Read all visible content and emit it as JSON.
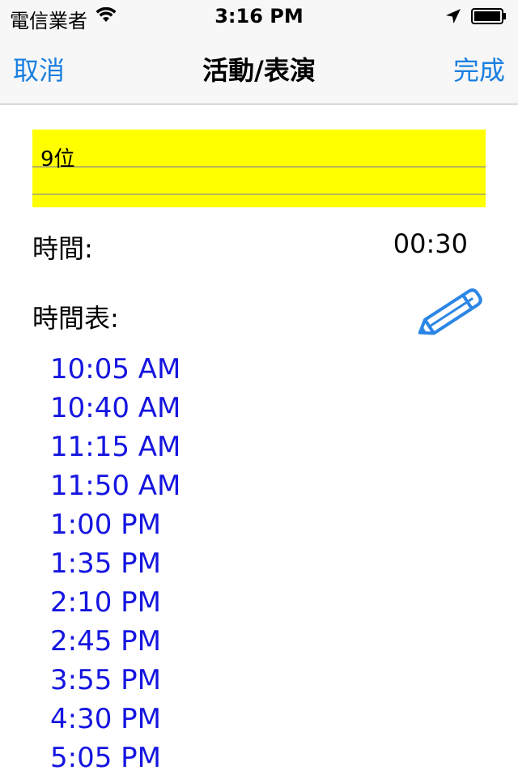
{
  "status_bar": {
    "carrier": "電信業者",
    "time": "3:16 PM"
  },
  "nav": {
    "cancel": "取消",
    "title": "活動/表演",
    "done": "完成"
  },
  "note": {
    "text": "9位"
  },
  "duration": {
    "label": "時間:",
    "value": "00:30"
  },
  "schedule": {
    "label": "時間表:",
    "times": [
      "10:05 AM",
      "10:40 AM",
      "11:15 AM",
      "11:50 AM",
      "1:00 PM",
      "1:35 PM",
      "2:10 PM",
      "2:45 PM",
      "3:55 PM",
      "4:30 PM",
      "5:05 PM"
    ]
  },
  "icons": {
    "wifi": "wifi-icon",
    "location": "location-arrow-icon",
    "battery": "battery-icon",
    "edit": "pencil-icon"
  },
  "colors": {
    "accent": "#1a7fe0",
    "schedule_text": "#1515e0",
    "note_background": "#ffff00"
  }
}
